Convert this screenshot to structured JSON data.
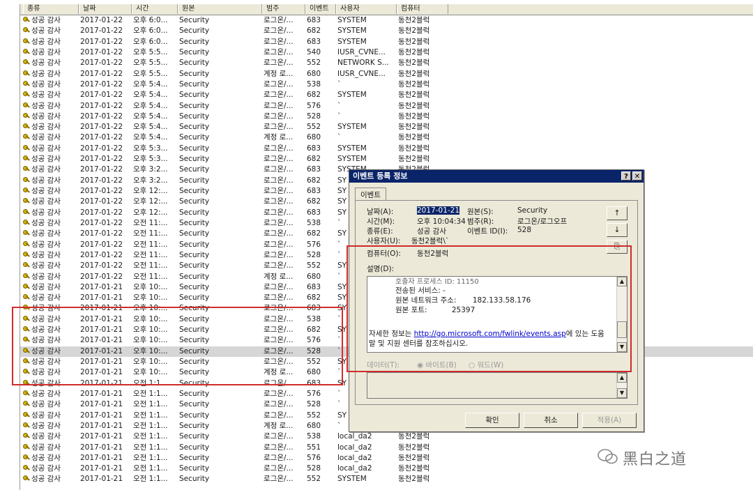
{
  "columns": [
    "종류",
    "날짜",
    "시간",
    "원본",
    "범주",
    "이벤트",
    "사용자",
    "컴퓨터"
  ],
  "rows": [
    [
      "성공 감사",
      "2017-01-22",
      "오후 6:0...",
      "Security",
      "로그온/...",
      "683",
      "SYSTEM",
      "동천2블럭"
    ],
    [
      "성공 감사",
      "2017-01-22",
      "오후 6:0...",
      "Security",
      "로그온/...",
      "682",
      "SYSTEM",
      "동천2블럭"
    ],
    [
      "성공 감사",
      "2017-01-22",
      "오후 6:0...",
      "Security",
      "로그온/...",
      "683",
      "SYSTEM",
      "동천2블럭"
    ],
    [
      "성공 감사",
      "2017-01-22",
      "오후 5:5...",
      "Security",
      "로그온/...",
      "540",
      "IUSR_CVNE...",
      "동천2블럭"
    ],
    [
      "성공 감사",
      "2017-01-22",
      "오후 5:5...",
      "Security",
      "로그온/...",
      "552",
      "NETWORK S...",
      "동천2블럭"
    ],
    [
      "성공 감사",
      "2017-01-22",
      "오후 5:5...",
      "Security",
      "계정 로...",
      "680",
      "IUSR_CVNE...",
      "동천2블럭"
    ],
    [
      "성공 감사",
      "2017-01-22",
      "오후 5:4...",
      "Security",
      "로그온/...",
      "538",
      "`",
      "동천2블럭"
    ],
    [
      "성공 감사",
      "2017-01-22",
      "오후 5:4...",
      "Security",
      "로그온/...",
      "682",
      "SYSTEM",
      "동천2블럭"
    ],
    [
      "성공 감사",
      "2017-01-22",
      "오후 5:4...",
      "Security",
      "로그온/...",
      "576",
      "`",
      "동천2블럭"
    ],
    [
      "성공 감사",
      "2017-01-22",
      "오후 5:4...",
      "Security",
      "로그온/...",
      "528",
      "`",
      "동천2블럭"
    ],
    [
      "성공 감사",
      "2017-01-22",
      "오후 5:4...",
      "Security",
      "로그온/...",
      "552",
      "SYSTEM",
      "동천2블럭"
    ],
    [
      "성공 감사",
      "2017-01-22",
      "오후 5:4...",
      "Security",
      "계정 로...",
      "680",
      "`",
      "동천2블럭"
    ],
    [
      "성공 감사",
      "2017-01-22",
      "오후 5:3...",
      "Security",
      "로그온/...",
      "683",
      "SYSTEM",
      "동천2블럭"
    ],
    [
      "성공 감사",
      "2017-01-22",
      "오후 5:3...",
      "Security",
      "로그온/...",
      "682",
      "SYSTEM",
      "동천2블럭"
    ],
    [
      "성공 감사",
      "2017-01-22",
      "오후 3:2...",
      "Security",
      "로그온/...",
      "683",
      "SYSTEM",
      "동천2블럭"
    ],
    [
      "성공 감사",
      "2017-01-22",
      "오후 3:2...",
      "Security",
      "로그온/...",
      "682",
      "SY",
      "동천2블럭"
    ],
    [
      "성공 감사",
      "2017-01-22",
      "오후 12:...",
      "Security",
      "로그온/...",
      "683",
      "SY",
      ""
    ],
    [
      "성공 감사",
      "2017-01-22",
      "오후 12:...",
      "Security",
      "로그온/...",
      "682",
      "SY",
      ""
    ],
    [
      "성공 감사",
      "2017-01-22",
      "오후 12:...",
      "Security",
      "로그온/...",
      "683",
      "SY",
      ""
    ],
    [
      "성공 감사",
      "2017-01-22",
      "오전 11:...",
      "Security",
      "로그온/...",
      "538",
      "`",
      ""
    ],
    [
      "성공 감사",
      "2017-01-22",
      "오전 11:...",
      "Security",
      "로그온/...",
      "682",
      "SY",
      ""
    ],
    [
      "성공 감사",
      "2017-01-22",
      "오전 11:...",
      "Security",
      "로그온/...",
      "576",
      "`",
      ""
    ],
    [
      "성공 감사",
      "2017-01-22",
      "오전 11:...",
      "Security",
      "로그온/...",
      "528",
      "`",
      ""
    ],
    [
      "성공 감사",
      "2017-01-22",
      "오전 11:...",
      "Security",
      "로그온/...",
      "552",
      "SY",
      ""
    ],
    [
      "성공 감사",
      "2017-01-22",
      "오전 11:...",
      "Security",
      "계정 로...",
      "680",
      "`",
      ""
    ],
    [
      "성공 감사",
      "2017-01-21",
      "오후 10:...",
      "Security",
      "로그온/...",
      "683",
      "SY",
      ""
    ],
    [
      "성공 감사",
      "2017-01-21",
      "오후 10:...",
      "Security",
      "로그온/...",
      "682",
      "SY",
      ""
    ],
    [
      "성공 감사",
      "2017-01-21",
      "오후 10:...",
      "Security",
      "로그온/...",
      "683",
      "SY",
      ""
    ],
    [
      "성공 감사",
      "2017-01-21",
      "오후 10:...",
      "Security",
      "로그온/...",
      "538",
      "`",
      ""
    ],
    [
      "성공 감사",
      "2017-01-21",
      "오후 10:...",
      "Security",
      "로그온/...",
      "682",
      "SY",
      ""
    ],
    [
      "성공 감사",
      "2017-01-21",
      "오후 10:...",
      "Security",
      "로그온/...",
      "576",
      "`",
      ""
    ],
    [
      "성공 감사",
      "2017-01-21",
      "오후 10:...",
      "Security",
      "로그온/...",
      "528",
      "`",
      ""
    ],
    [
      "성공 감사",
      "2017-01-21",
      "오후 10:...",
      "Security",
      "로그온/...",
      "552",
      "SY",
      ""
    ],
    [
      "성공 감사",
      "2017-01-21",
      "오후 10:...",
      "Security",
      "계정 로...",
      "680",
      "`",
      ""
    ],
    [
      "성공 감사",
      "2017-01-21",
      "오전 1:1...",
      "Security",
      "로그온/...",
      "683",
      "SY",
      ""
    ],
    [
      "성공 감사",
      "2017-01-21",
      "오전 1:1...",
      "Security",
      "로그온/...",
      "576",
      "`",
      ""
    ],
    [
      "성공 감사",
      "2017-01-21",
      "오전 1:1...",
      "Security",
      "로그온/...",
      "528",
      "`",
      ""
    ],
    [
      "성공 감사",
      "2017-01-21",
      "오전 1:1...",
      "Security",
      "로그온/...",
      "552",
      "SY",
      ""
    ],
    [
      "성공 감사",
      "2017-01-21",
      "오전 1:1...",
      "Security",
      "계정 로...",
      "680",
      "`",
      ""
    ],
    [
      "성공 감사",
      "2017-01-21",
      "오전 1:1...",
      "Security",
      "로그온/...",
      "538",
      "local_da2",
      "동천2블럭"
    ],
    [
      "성공 감사",
      "2017-01-21",
      "오전 1:1...",
      "Security",
      "로그온/...",
      "551",
      "local_da2",
      "동천2블럭"
    ],
    [
      "성공 감사",
      "2017-01-21",
      "오전 1:1...",
      "Security",
      "로그온/...",
      "576",
      "local_da2",
      "동천2블럭"
    ],
    [
      "성공 감사",
      "2017-01-21",
      "오전 1:1...",
      "Security",
      "로그온/...",
      "528",
      "local_da2",
      "동천2블럭"
    ],
    [
      "성공 감사",
      "2017-01-21",
      "오전 1:1...",
      "Security",
      "로그온/...",
      "552",
      "SYSTEM",
      "동천2블럭"
    ]
  ],
  "selected_row": 31,
  "dialog": {
    "title": "이벤트 등록 정보",
    "help_glyph": "?",
    "close_glyph": "✕",
    "tab": "이벤트",
    "date_label": "날짜(A):",
    "date_value": "2017-01-21",
    "time_label": "시간(M):",
    "time_value": "오후 10:04:34",
    "type_label": "종류(E):",
    "type_value": "성공 감사",
    "user_label": "사용자(U):",
    "user_value": "동천2블럭\\`",
    "computer_label": "컴퓨터(O):",
    "computer_value": "동천2블럭",
    "source_label": "원본(S):",
    "source_value": "Security",
    "category_label": "범주(R):",
    "category_value": "로그온/로그오프",
    "eventid_label": "이벤트 ID(I):",
    "eventid_value": "528",
    "desc_label": "설명(D):",
    "desc_line0": "호출자 프로세스 ID: 11150",
    "desc_line1": "전송된 서비스: -",
    "desc_line2_label": "원본 네트워크 주소:",
    "desc_line2_value": "182.133.58.176",
    "desc_line3_label": "원본 포트:",
    "desc_line3_value": "25397",
    "desc_more_prefix": "자세한 정보는 ",
    "desc_link": "http://go.microsoft.com/fwlink/events.asp",
    "desc_more_suffix": "에 있는 도움",
    "desc_more_line2": "말 및 지원 센터를 참조하십시오.",
    "data_label": "데이터(T):",
    "bytes_label": "바이트(B)",
    "words_label": "워드(W)",
    "up_glyph": "↑",
    "down_glyph": "↓",
    "copy_glyph": "⎘",
    "ok": "확인",
    "cancel": "취소",
    "apply": "적용(A)"
  },
  "watermark": "黑白之道",
  "colors": {
    "title_bar": "#0a246a",
    "highlight_box": "#d02a2a",
    "dialog_bg": "#ece9d8"
  }
}
